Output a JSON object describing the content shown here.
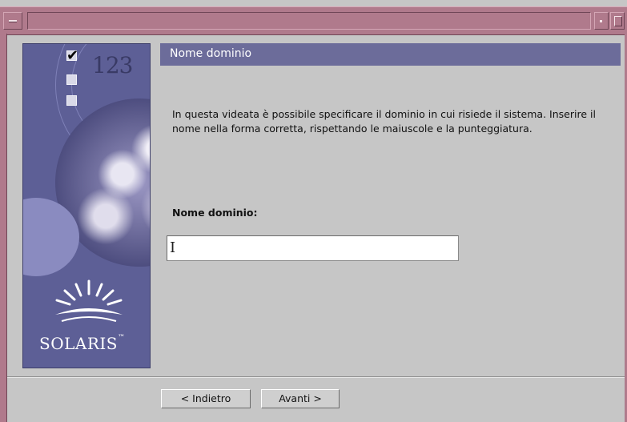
{
  "window": {
    "title": ""
  },
  "side_panel": {
    "step_numbers": "123",
    "brand": "SOLARIS",
    "trademark": "™"
  },
  "header": {
    "title": "Nome dominio"
  },
  "main": {
    "description": "In questa videata è possibile specificare il dominio in cui risiede il sistema. Inserire il nome nella forma corretta, rispettando le maiuscole e la punteggiatura.",
    "field_label": "Nome dominio:",
    "input_value": "",
    "cursor_glyph": "I"
  },
  "footer": {
    "back_label": "< Indietro",
    "next_label": "Avanti >"
  },
  "colors": {
    "titlebar": "#b07a8c",
    "panel": "#5d5f96",
    "header_band": "#6c6c9a",
    "background": "#c6c6c6"
  }
}
